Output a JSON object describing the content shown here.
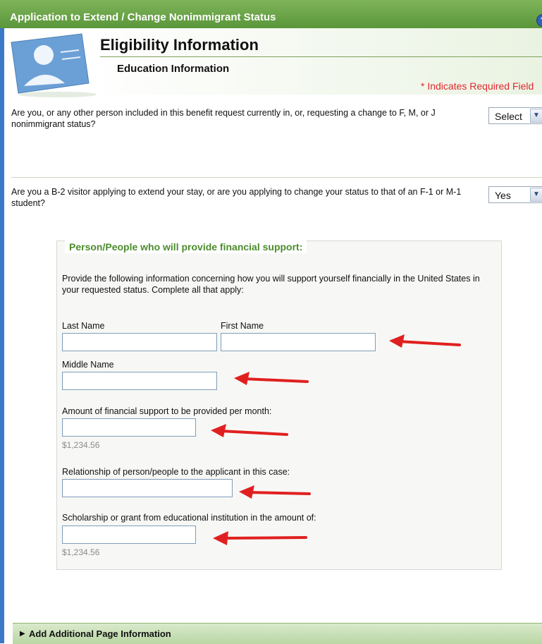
{
  "window": {
    "title": "Application to Extend / Change Nonimmigrant Status"
  },
  "header": {
    "heading": "Eligibility Information",
    "subheading": "Education Information",
    "required_note": "* Indicates Required Field"
  },
  "questions": [
    {
      "text": "Are you, or any other person included in this benefit request currently in, or, requesting a change to F, M, or J nonimmigrant status?",
      "selected": "Select"
    },
    {
      "text": "Are you a B-2 visitor applying to extend your stay, or are you applying to change your status to that of an F-1 or M-1 student?",
      "selected": "Yes"
    }
  ],
  "support": {
    "legend": "Person/People who will provide financial support:",
    "instructions": "Provide the following information concerning how you will support yourself financially in the United States in your requested status. Complete all that apply:",
    "last_name_label": "Last Name",
    "first_name_label": "First Name",
    "middle_name_label": "Middle Name",
    "amount_label": "Amount of financial support to be provided per month:",
    "amount_hint": "$1,234.56",
    "relationship_label": "Relationship of person/people to the applicant in this case:",
    "scholarship_label": "Scholarship or grant from educational institution in the amount of:",
    "scholarship_hint": "$1,234.56"
  },
  "footer": {
    "label": "Add Additional Page Information"
  },
  "colors": {
    "brand_green": "#5a963a",
    "annotation_red": "#e02020",
    "required_red": "#e2282f"
  }
}
